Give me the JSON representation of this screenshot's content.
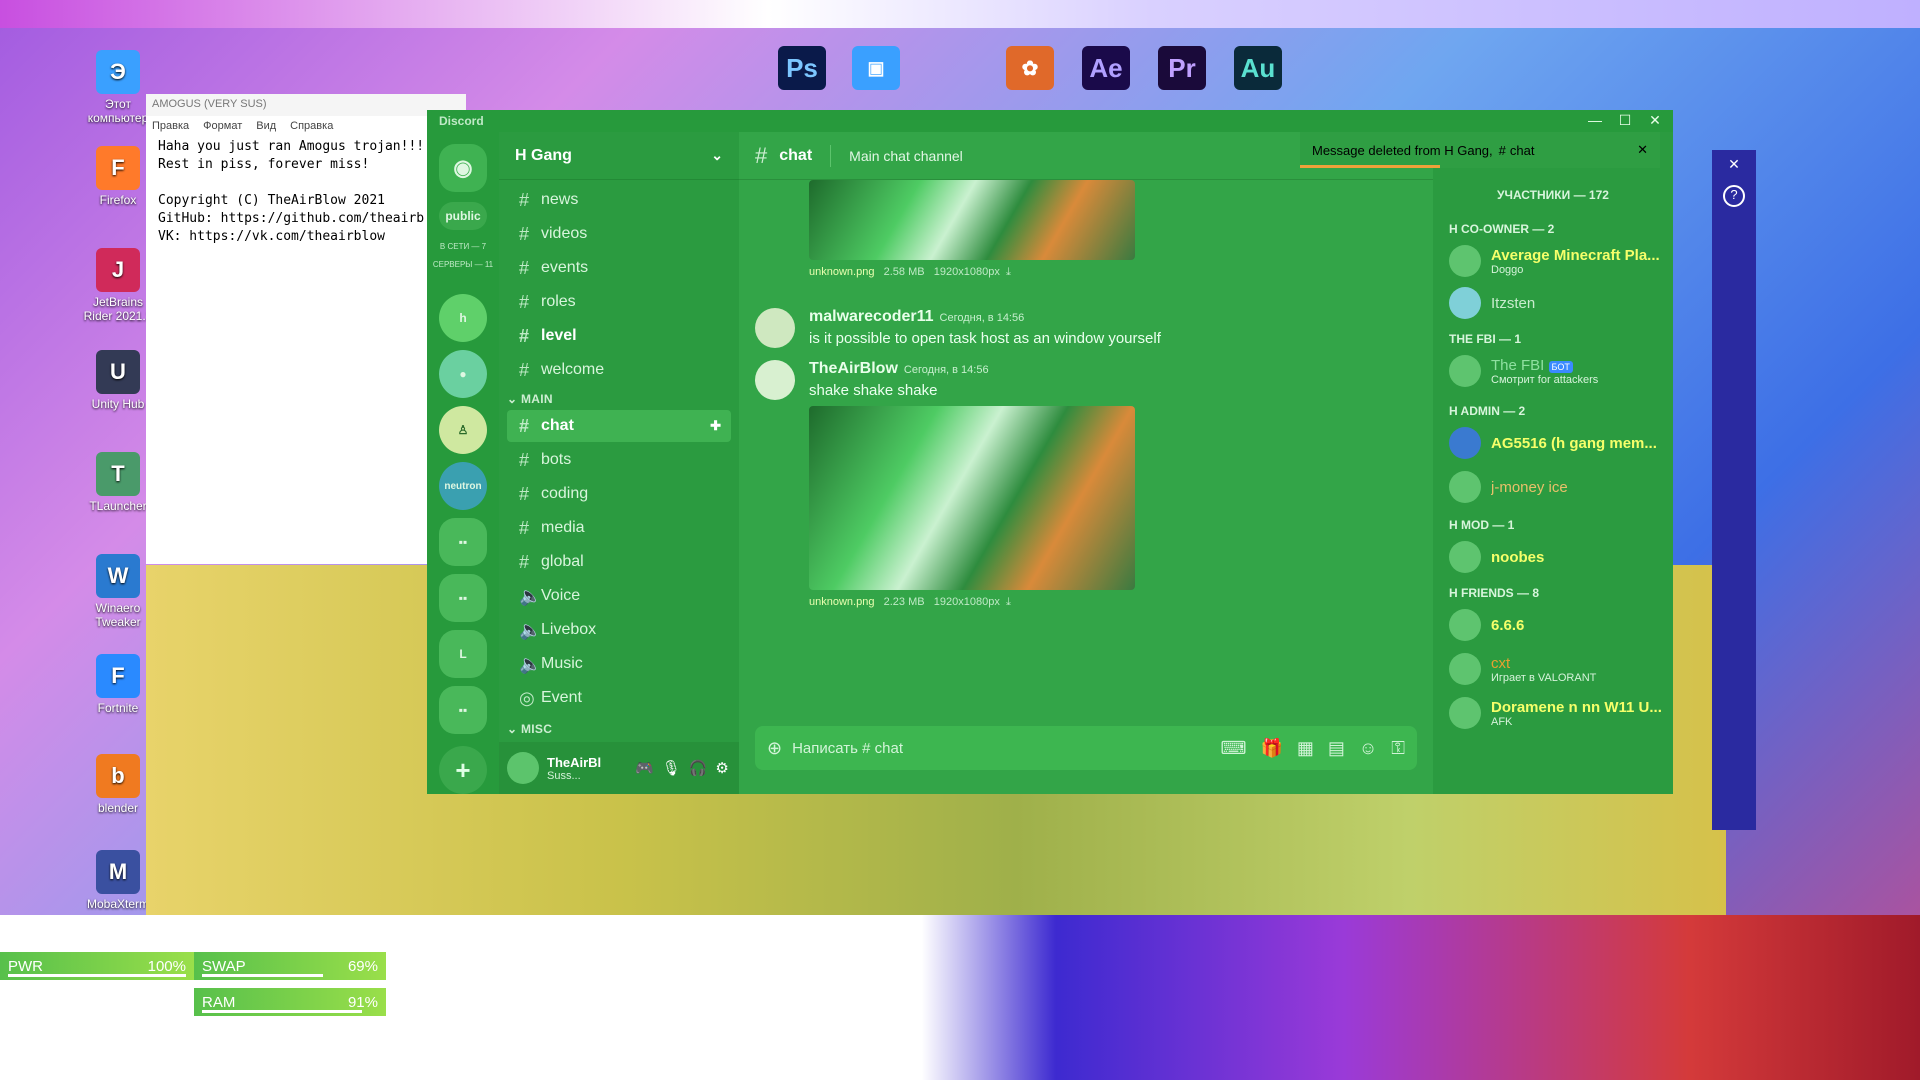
{
  "desktop": {
    "icons": [
      {
        "label": "Этот компьютер",
        "icon": "computer-icon",
        "color": "#3aa0ff"
      },
      {
        "label": "Firefox",
        "icon": "firefox-icon",
        "color": "#ff7a2a"
      },
      {
        "label": "JetBrains Rider 2021.1",
        "icon": "rider-icon",
        "color": "#d02a5a"
      },
      {
        "label": "Unity Hub",
        "icon": "unity-icon",
        "color": "#333a55"
      },
      {
        "label": "TLauncher",
        "icon": "tlauncher-icon",
        "color": "#4a9a6a"
      },
      {
        "label": "Winaero Tweaker",
        "icon": "winaero-icon",
        "color": "#2a7ad0"
      },
      {
        "label": "Fortnite",
        "icon": "fortnite-icon",
        "color": "#2a8aff"
      },
      {
        "label": "blender",
        "icon": "blender-icon",
        "color": "#f07a20"
      },
      {
        "label": "MobaXterm",
        "icon": "mobaxterm-icon",
        "color": "#3a50a0"
      }
    ],
    "top_apps": [
      "Ps",
      "Ae",
      "Pr",
      "Au"
    ]
  },
  "notepad": {
    "title": "AMOGUS (VERY SUS)",
    "menu": [
      "Правка",
      "Формат",
      "Вид",
      "Справка"
    ],
    "lines": [
      "Haha you just ran Amogus trojan!!!",
      "Rest in piss, forever miss!",
      "",
      "Copyright (C) TheAirBlow 2021",
      "GitHub: https://github.com/theairb",
      "VK: https://vk.com/theairblow"
    ]
  },
  "discord": {
    "app_name": "Discord",
    "server_list": {
      "public_label": "public",
      "online_label": "В СЕТИ — 7",
      "servers_label": "СЕРВЕРЫ — 11",
      "neutron_label": "neutron"
    },
    "guild_name": "H Gang",
    "channels_top": [
      "news",
      "videos",
      "events",
      "roles",
      "level",
      "welcome"
    ],
    "category_main": "MAIN",
    "channels_main": [
      "chat",
      "bots",
      "coding",
      "media",
      "global"
    ],
    "voice_channels": [
      "Voice",
      "Livebox",
      "Music",
      "Event"
    ],
    "category_misc": "MISC",
    "user": {
      "name": "TheAirBl",
      "status": "Suss..."
    },
    "chat_header": {
      "channel": "chat",
      "topic": "Main chat channel"
    },
    "toast": {
      "text": "Message deleted from H Gang,",
      "channel": "chat"
    },
    "messages": [
      {
        "attachment": {
          "file": "unknown.png",
          "size": "2.58 MB",
          "dims": "1920x1080px"
        }
      },
      {
        "author": "malwarecoder11",
        "time": "Сегодня, в 14:56",
        "text": "is it possible to open task host as an window yourself"
      },
      {
        "author": "TheAirBlow",
        "time": "Сегодня, в 14:56",
        "text": "shake shake shake",
        "attachment": {
          "file": "unknown.png",
          "size": "2.23 MB",
          "dims": "1920x1080px"
        }
      }
    ],
    "composer_placeholder": "Написать #",
    "composer_channel": "chat",
    "members": {
      "header": "УЧАСТНИКИ — 172",
      "groups": [
        {
          "title": "H CO-OWNER — 2",
          "members": [
            {
              "name": "Average Minecraft Pla...",
              "sub": "Doggo"
            },
            {
              "name": "Itzsten",
              "sub": ""
            }
          ]
        },
        {
          "title": "THE FBI — 1",
          "members": [
            {
              "name": "The FBI",
              "badge": "БОТ",
              "sub": "Смотрит for attackers"
            }
          ]
        },
        {
          "title": "H ADMIN — 2",
          "members": [
            {
              "name": "AG5516 (h gang mem...",
              "sub": ""
            },
            {
              "name": "j-money ice",
              "sub": ""
            }
          ]
        },
        {
          "title": "H MOD — 1",
          "members": [
            {
              "name": "noobes",
              "sub": ""
            }
          ]
        },
        {
          "title": "H FRIENDS — 8",
          "members": [
            {
              "name": "6.6.6",
              "sub": ""
            },
            {
              "name": "cxt",
              "sub": "Играет в VALORANT"
            },
            {
              "name": "Doramene n nn W11 U...",
              "sub": "AFK"
            }
          ]
        }
      ]
    }
  },
  "widgets": {
    "pwr": {
      "label": "PWR",
      "value": "100%",
      "level": 1.0
    },
    "swap": {
      "label": "SWAP",
      "value": "69%",
      "level": 0.69
    },
    "ram": {
      "label": "RAM",
      "value": "91%",
      "level": 0.91
    }
  }
}
